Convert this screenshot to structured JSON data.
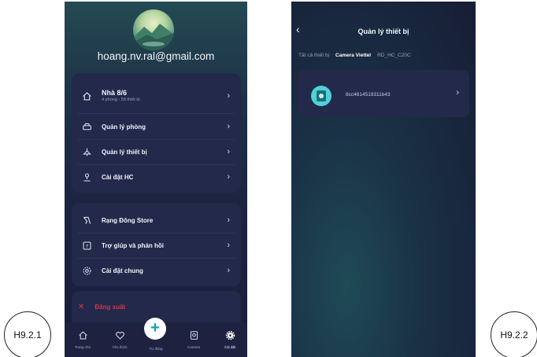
{
  "labels": {
    "left": "H9.2.1",
    "right": "H9.2.2"
  },
  "screen1": {
    "email": "hoang.nv.ral@gmail.com",
    "home": {
      "name": "Nhà 8/6",
      "detail": "4 phòng - 59 thiết bị"
    },
    "menu1": [
      "Quản lý phòng",
      "Quản lý thiết bị",
      "Cài đặt HC"
    ],
    "menu2": [
      "Rạng Đông Store",
      "Trợ giúp và phản hồi",
      "Cài đặt chung"
    ],
    "logout": "Đăng xuất",
    "nav": {
      "home": "Trang chủ",
      "favorite": "Yêu thích",
      "auto": "Tự động",
      "camera": "Camera",
      "settings": "Cài đặt",
      "fab": "+"
    },
    "chevron": "›"
  },
  "screen2": {
    "back": "‹",
    "title": "Quản lý thiết bị",
    "tabs": [
      "Tất cả thiết bị",
      "Camera Viettel",
      "RD_HC_C20C"
    ],
    "active_tab": "Camera Viettel",
    "device_id": "8cc4614519311b43",
    "chevron": "›"
  },
  "colors": {
    "card": "#23294b",
    "accent": "#0ea3b8",
    "logout": "#e0364b",
    "camera_icon": "#4dd2d6"
  },
  "icons": [
    "home-icon",
    "car-icon",
    "lamp-icon",
    "hub-icon",
    "store-icon",
    "help-icon",
    "settings-gear-icon",
    "close-icon",
    "heart-icon",
    "camera-icon",
    "gear-icon",
    "plus-icon",
    "chevron-left-icon",
    "chevron-right-icon"
  ]
}
